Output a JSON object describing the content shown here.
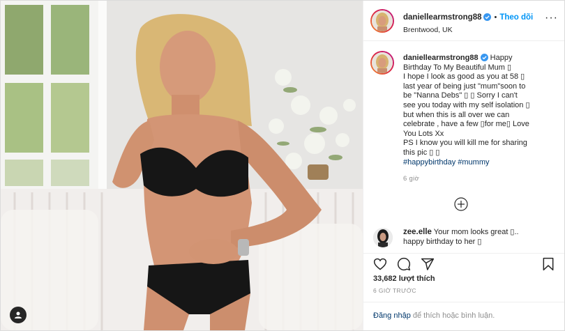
{
  "post": {
    "username": "daniellearmstrong88",
    "follow_label": "Theo dõi",
    "dot": "•",
    "location": "Brentwood, UK",
    "more_icon": "more-options-icon",
    "caption_lines": [
      "Happy",
      "Birthday To My Beautiful Mum ▯",
      "I hope I look as good as you at 58 ▯",
      "last year of being just \"mum\"soon to",
      "be \"Nanna Debs\" ▯ ▯ Sorry I can't",
      "see you today with my self isolation ▯",
      "but when this is all over we can",
      "celebrate , have a few ▯for me▯ Love",
      "You Lots Xx",
      "PS I know you will kill me for sharing",
      "this pic ▯ ▯"
    ],
    "hashtags": "#happybirthday #mummy",
    "caption_time": "6 giờ",
    "comments": [
      {
        "username": "zee.elle",
        "line1": "Your mom looks great ▯..",
        "line2": "happy birthday to her ▯"
      }
    ],
    "likes": "33,682 lượt thích",
    "time_ago": "6 GIỜ TRƯỚC",
    "login_link": "Đăng nhập",
    "login_rest": " để thích hoặc bình luận.",
    "colors": {
      "accent": "#0095f6",
      "hashtag": "#00376b",
      "muted": "#8e8e8e"
    }
  }
}
